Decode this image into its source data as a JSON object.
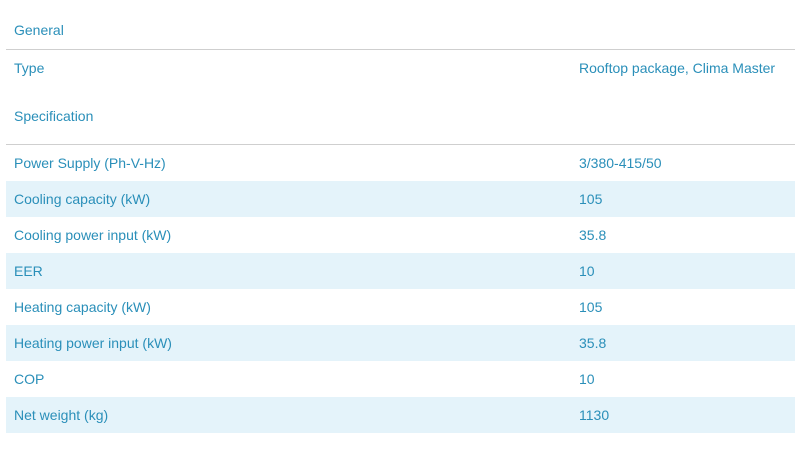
{
  "general": {
    "heading": "General",
    "rows": [
      {
        "label": "Type",
        "value": "Rooftop package, Clima Master"
      }
    ]
  },
  "specification": {
    "heading": "Specification",
    "rows": [
      {
        "label": "Power Supply (Ph-V-Hz)",
        "value": "3/380-415/50"
      },
      {
        "label": "Cooling capacity (kW)",
        "value": "105"
      },
      {
        "label": "Cooling power input (kW)",
        "value": "35.8"
      },
      {
        "label": "EER",
        "value": "10"
      },
      {
        "label": "Heating capacity (kW)",
        "value": "105"
      },
      {
        "label": "Heating power input (kW)",
        "value": "35.8"
      },
      {
        "label": "COP",
        "value": "10"
      },
      {
        "label": "Net weight (kg)",
        "value": "1130"
      }
    ]
  },
  "colors": {
    "text": "#2a8fb9",
    "stripe": "#e4f3fa",
    "divider": "#cfcfcf"
  }
}
